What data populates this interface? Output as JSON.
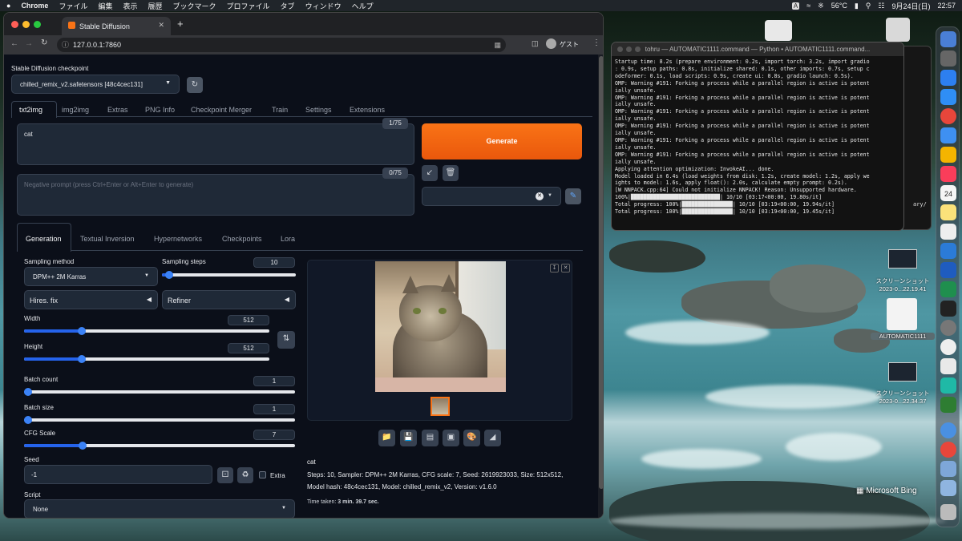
{
  "menubar": {
    "app": "Chrome",
    "items": [
      "ファイル",
      "編集",
      "表示",
      "履歴",
      "ブックマーク",
      "プロファイル",
      "タブ",
      "ウィンドウ",
      "ヘルプ"
    ],
    "input_mode": "A",
    "temperature": "56°C",
    "date": "9月24日(日)",
    "time": "22:57"
  },
  "browser": {
    "tab_title": "Stable Diffusion",
    "url": "127.0.0.1:7860",
    "profile": "ゲスト"
  },
  "sd": {
    "checkpoint_label": "Stable Diffusion checkpoint",
    "checkpoint_value": "chilled_remix_v2.safetensors [48c4cec131]",
    "main_tabs": [
      "txt2img",
      "img2img",
      "Extras",
      "PNG Info",
      "Checkpoint Merger",
      "Train",
      "Settings",
      "Extensions"
    ],
    "prompt": "cat",
    "prompt_count": "1/75",
    "negative_placeholder": "Negative prompt (press Ctrl+Enter or Alt+Enter to generate)",
    "negative_count": "0/75",
    "generate_label": "Generate",
    "sub_tabs": [
      "Generation",
      "Textual Inversion",
      "Hypernetworks",
      "Checkpoints",
      "Lora"
    ],
    "sampling_method_label": "Sampling method",
    "sampling_method_value": "DPM++ 2M Karras",
    "sampling_steps_label": "Sampling steps",
    "sampling_steps": "10",
    "hires_label": "Hires. fix",
    "refiner_label": "Refiner",
    "width_label": "Width",
    "width": "512",
    "height_label": "Height",
    "height": "512",
    "batch_count_label": "Batch count",
    "batch_count": "1",
    "batch_size_label": "Batch size",
    "batch_size": "1",
    "cfg_label": "CFG Scale",
    "cfg": "7",
    "seed_label": "Seed",
    "seed": "-1",
    "extra_label": "Extra",
    "script_label": "Script",
    "script_value": "None",
    "output_prompt": "cat",
    "output_info_1": "Steps: 10, Sampler: DPM++ 2M Karras, CFG scale: 7, Seed: 2619923033, Size: 512x512,",
    "output_info_2": "Model hash: 48c4cec131, Model: chilled_remix_v2, Version: v1.6.0",
    "time_taken_label": "Time taken:",
    "time_taken": "3 min. 39.7 sec."
  },
  "terminal": {
    "title": "tohru — AUTOMATIC1111.command — Python • AUTOMATIC1111.command...",
    "lines": [
      "Startup time: 8.2s (prepare environment: 0.2s, import torch: 3.2s, import gradio",
      ": 0.9s, setup paths: 0.8s, initialize shared: 0.1s, other imports: 0.7s, setup c",
      "odeformer: 0.1s, load scripts: 0.9s, create ui: 0.8s, gradio launch: 0.5s).",
      "OMP: Warning #191: Forking a process while a parallel region is active is potent",
      "ially unsafe.",
      "OMP: Warning #191: Forking a process while a parallel region is active is potent",
      "ially unsafe.",
      "OMP: Warning #191: Forking a process while a parallel region is active is potent",
      "ially unsafe.",
      "OMP: Warning #191: Forking a process while a parallel region is active is potent",
      "ially unsafe.",
      "OMP: Warning #191: Forking a process while a parallel region is active is potent",
      "ially unsafe.",
      "OMP: Warning #191: Forking a process while a parallel region is active is potent",
      "ially unsafe.",
      "Applying attention optimization: InvokeAI... done.",
      "Model loaded in 6.4s (load weights from disk: 1.2s, create model: 1.2s, apply we",
      "ights to model: 1.6s, apply float(): 2.0s, calculate empty prompt: 0.2s).",
      "[W NNPACK.cpp:64] Could not initialize NNPACK! Reason: Unsupported hardware.",
      "100%|████████████████████████████| 10/10 [03:17<00:00, 19.80s/it]",
      "Total progress: 100%|████████████████| 10/10 [03:19<00:00, 19.94s/it]",
      "Total progress: 100%|████████████████| 10/10 [03:19<00:00, 19.45s/it]"
    ],
    "behind_text": "ary/"
  },
  "desktop": {
    "file1_label_1": "スクリーンショット",
    "file1_label_2": "2023-0...22.19.41",
    "file2_label": "AUTOMATIC1111",
    "file3_label_1": "スクリーンショット",
    "file3_label_2": "2023-0...22.34.37",
    "bing": "Microsoft Bing",
    "dock_date": "24"
  },
  "colors": {
    "accent": "#ea580c",
    "slider": "#3b82f6"
  }
}
